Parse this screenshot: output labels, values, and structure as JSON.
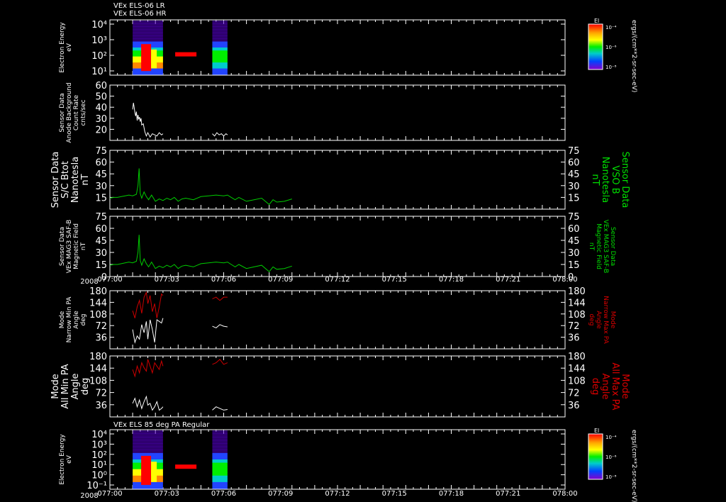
{
  "header": {
    "lines": [
      "VEx ELS-06 LR",
      "VEx ELS-06 HR"
    ]
  },
  "footer_year": "2008",
  "time_axis": {
    "start": "077:00",
    "end": "078:00",
    "tick_labels": [
      "077:00",
      "077:03",
      "077:06",
      "077:09",
      "077:12",
      "077:15",
      "077:18",
      "077:21",
      "078:00"
    ]
  },
  "colors": {
    "background": "#000000",
    "frame": "#ffffff",
    "white_series": "#ffffff",
    "green_series": "#00cc00",
    "red_series": "#cc0000",
    "green_label": "#00e000",
    "red_label": "#dd0000"
  },
  "panels": [
    {
      "id": "p1",
      "kind": "spectrogram",
      "left_label_lines": [
        "Electron Energy",
        "eV"
      ],
      "y_ticks": [
        "10⁴",
        "10³",
        "10²",
        "10¹"
      ],
      "colorbar": {
        "title": "El",
        "tick_labels": [
          "10⁻⁴",
          "10⁻⁶",
          "10⁻⁸"
        ],
        "unit": "ergs/(cm**2-sr-sec-eV)"
      },
      "blocks": [
        {
          "start": "077:03",
          "end": "077:07"
        },
        {
          "start": "077:13.5",
          "end": "077:15.5"
        }
      ]
    },
    {
      "id": "p2",
      "kind": "line",
      "left_label_lines": [
        "Sensor Data",
        "Anode Background",
        "Count Rate",
        "cnts/sec"
      ],
      "ylim": [
        10,
        60
      ],
      "y_ticks": [
        "60",
        "50",
        "40",
        "30",
        "20"
      ],
      "series": [
        {
          "color_key": "white_series",
          "x_min": [
            3.0,
            3.1,
            3.2,
            3.3,
            3.4,
            3.5,
            3.6,
            3.7,
            3.8,
            3.9,
            4.0,
            4.1,
            4.2,
            4.4,
            4.6,
            4.8,
            5.0,
            5.3,
            5.6,
            5.9,
            6.2,
            6.5,
            6.8,
            7.0
          ],
          "y": [
            38,
            44,
            40,
            35,
            32,
            36,
            28,
            33,
            29,
            31,
            27,
            30,
            24,
            25,
            18,
            14,
            17,
            13,
            16,
            15,
            14,
            17,
            15,
            16
          ]
        },
        {
          "color_key": "white_series",
          "x_min": [
            13.5,
            13.8,
            14.1,
            14.4,
            14.7,
            15.0,
            15.3,
            15.5
          ],
          "y": [
            16,
            14,
            17,
            15,
            16,
            14,
            16,
            15
          ]
        }
      ]
    },
    {
      "id": "p3",
      "kind": "line",
      "left_label_lines": [
        "Sensor Data",
        "S/C Btot",
        "Nanotesla",
        "nT"
      ],
      "right_label_lines": [
        "Sensor Data",
        "VSO B",
        "Nanotesla",
        "nT"
      ],
      "ylim": [
        0,
        75
      ],
      "y_ticks": [
        "75",
        "60",
        "45",
        "30",
        "15"
      ],
      "series": [
        {
          "color_key": "green_series",
          "x_min": [
            0,
            0.5,
            1,
            1.5,
            2,
            2.5,
            3,
            3.5,
            3.7,
            3.85,
            4.0,
            4.2,
            4.5,
            4.8,
            5.1,
            5.5,
            6,
            6.5,
            7,
            7.5,
            8,
            8.5,
            9,
            9.5,
            10,
            11,
            12,
            13,
            14,
            15,
            15.5,
            16,
            16.5,
            17,
            18,
            19,
            20,
            21,
            21.5,
            22,
            23,
            24
          ],
          "y": [
            14,
            15,
            15,
            16,
            17,
            18,
            17,
            19,
            30,
            52,
            20,
            14,
            22,
            16,
            12,
            18,
            10,
            13,
            11,
            14,
            12,
            15,
            10,
            13,
            14,
            12,
            16,
            17,
            18,
            17,
            18,
            15,
            12,
            15,
            10,
            12,
            14,
            6,
            12,
            9,
            10,
            13
          ]
        }
      ]
    },
    {
      "id": "p4",
      "kind": "line",
      "left_label_lines": [
        "Sensor Data",
        "VEx MAG3 SAF-B",
        "Magnetic Field",
        "nT"
      ],
      "right_label_lines": [
        "Sensor Data",
        "VEx MAG3 SAF-B",
        "Magnetic Field",
        "nT"
      ],
      "ylim": [
        0,
        75
      ],
      "y_ticks": [
        "75",
        "60",
        "45",
        "30",
        "15",
        "0"
      ],
      "series": [
        {
          "color_key": "green_series",
          "x_min": [
            0,
            0.5,
            1,
            1.5,
            2,
            2.5,
            3,
            3.5,
            3.7,
            3.85,
            4.0,
            4.2,
            4.5,
            4.8,
            5.1,
            5.5,
            6,
            6.5,
            7,
            7.5,
            8,
            8.5,
            9,
            9.5,
            10,
            11,
            12,
            13,
            14,
            15,
            15.5,
            16,
            16.5,
            17,
            18,
            19,
            20,
            21,
            21.5,
            22,
            23,
            24
          ],
          "y": [
            14,
            15,
            15,
            16,
            17,
            18,
            17,
            19,
            30,
            52,
            20,
            14,
            22,
            16,
            12,
            18,
            10,
            13,
            11,
            14,
            12,
            15,
            10,
            13,
            14,
            12,
            16,
            17,
            18,
            17,
            18,
            15,
            12,
            15,
            10,
            12,
            14,
            6,
            12,
            9,
            10,
            13
          ]
        }
      ]
    },
    {
      "id": "p5",
      "kind": "line",
      "left_label_lines": [
        "Mode",
        "Narrow Min PA",
        "Angle",
        "deg"
      ],
      "right_label_lines": [
        "Mode",
        "Narrow Max PA",
        "Angle",
        "deg"
      ],
      "ylim": [
        0,
        180
      ],
      "y_ticks": [
        "180",
        "144",
        "108",
        "72",
        "36"
      ],
      "series": [
        {
          "color_key": "red_series",
          "x_min": [
            3.0,
            3.3,
            3.6,
            3.9,
            4.2,
            4.5,
            4.8,
            5.0,
            5.3,
            5.6,
            5.9,
            6.2,
            6.5,
            6.8,
            7.0
          ],
          "y": [
            118,
            95,
            130,
            150,
            110,
            160,
            175,
            140,
            165,
            115,
            140,
            95,
            130,
            170,
            165
          ]
        },
        {
          "color_key": "white_series",
          "x_min": [
            3.0,
            3.3,
            3.6,
            3.9,
            4.2,
            4.5,
            4.8,
            5.0,
            5.3,
            5.6,
            5.9,
            6.2,
            6.5,
            6.8,
            7.0
          ],
          "y": [
            60,
            20,
            40,
            30,
            75,
            50,
            85,
            30,
            90,
            60,
            20,
            90,
            85,
            80,
            95
          ]
        },
        {
          "color_key": "red_series",
          "x_min": [
            13.5,
            14.0,
            14.5,
            15.0,
            15.5
          ],
          "y": [
            155,
            160,
            150,
            160,
            160
          ]
        },
        {
          "color_key": "white_series",
          "x_min": [
            13.5,
            14.0,
            14.5,
            15.0,
            15.5
          ],
          "y": [
            70,
            65,
            75,
            70,
            68
          ]
        }
      ]
    },
    {
      "id": "p6",
      "kind": "line",
      "left_label_lines": [
        "Mode",
        "All Min PA",
        "Angle",
        "deg"
      ],
      "right_label_lines": [
        "Mode",
        "All Max PA",
        "Angle",
        "deg"
      ],
      "ylim": [
        0,
        180
      ],
      "y_ticks": [
        "180",
        "144",
        "108",
        "72",
        "36"
      ],
      "series": [
        {
          "color_key": "red_series",
          "x_min": [
            3.0,
            3.3,
            3.6,
            3.9,
            4.2,
            4.5,
            4.8,
            5.0,
            5.3,
            5.6,
            5.9,
            6.2,
            6.5,
            6.8,
            7.0
          ],
          "y": [
            140,
            120,
            150,
            130,
            160,
            145,
            135,
            170,
            150,
            130,
            160,
            150,
            140,
            165,
            150
          ]
        },
        {
          "color_key": "white_series",
          "x_min": [
            3.0,
            3.3,
            3.6,
            3.9,
            4.2,
            4.5,
            4.8,
            5.0,
            5.3,
            5.6,
            5.9,
            6.2,
            6.5,
            6.8,
            7.0
          ],
          "y": [
            40,
            55,
            30,
            50,
            25,
            45,
            60,
            35,
            40,
            20,
            30,
            45,
            20,
            25,
            30
          ]
        },
        {
          "color_key": "red_series",
          "x_min": [
            13.5,
            14.0,
            14.5,
            15.0,
            15.5
          ],
          "y": [
            155,
            160,
            170,
            155,
            160
          ]
        },
        {
          "color_key": "white_series",
          "x_min": [
            13.5,
            14.0,
            14.5,
            15.0,
            15.5
          ],
          "y": [
            20,
            30,
            25,
            20,
            22
          ]
        }
      ]
    },
    {
      "id": "p7",
      "kind": "spectrogram",
      "left_label_lines": [
        "Electron Energy",
        "eV"
      ],
      "title": "VEx ELS 85 deg PA Regular",
      "y_ticks": [
        "10⁴",
        "10³",
        "10²",
        "10¹",
        "10⁰",
        "10⁻¹"
      ],
      "colorbar": {
        "title": "El",
        "tick_labels": [
          "10⁻⁴",
          "10⁻⁶",
          "10⁻⁸"
        ],
        "unit": "ergs/(cm**2-sr-sec-eV)"
      },
      "blocks": [
        {
          "start": "077:03",
          "end": "077:07"
        },
        {
          "start": "077:13.5",
          "end": "077:15.5"
        }
      ]
    }
  ]
}
